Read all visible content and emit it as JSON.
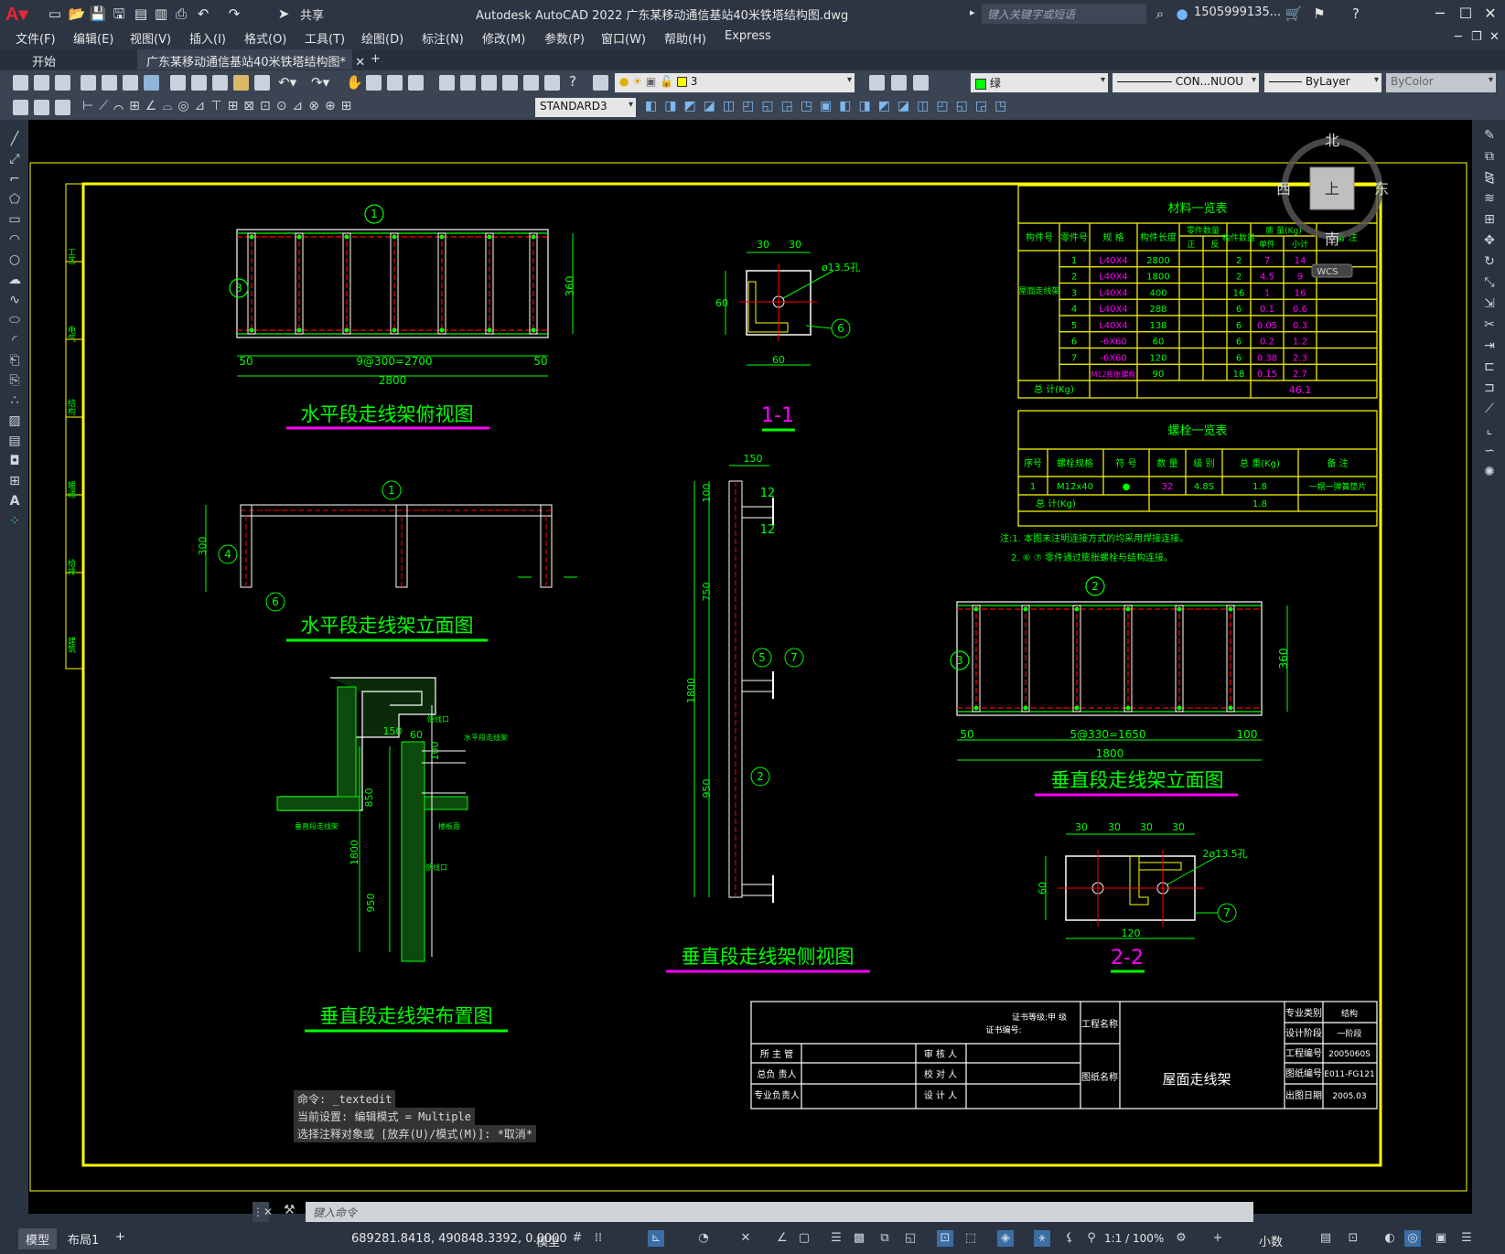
{
  "window": {
    "title": "Autodesk AutoCAD 2022    广东某移动通信基站40米铁塔结构图.dwg",
    "share": "共享",
    "search_placeholder": "键入关键字或短语",
    "user": "1505999135...",
    "minimize": "─",
    "maximize": "☐",
    "close": "✕"
  },
  "menu": [
    "文件(F)",
    "编辑(E)",
    "视图(V)",
    "插入(I)",
    "格式(O)",
    "工具(T)",
    "绘图(D)",
    "标注(N)",
    "修改(M)",
    "参数(P)",
    "窗口(W)",
    "帮助(H)",
    "Express"
  ],
  "tabs": {
    "start": "开始",
    "drawing": "广东某移动通信基站40米铁塔结构图*",
    "close": "✕",
    "add": "+"
  },
  "toolbar": {
    "layer": "3",
    "color": "绿",
    "linetype": "CON...NUOU",
    "lineweight": "ByLayer",
    "plotstyle": "ByColor",
    "textstyle": "STANDARD3"
  },
  "viewcube": {
    "north": "北",
    "south": "南",
    "east": "东",
    "west": "西",
    "top": "上",
    "wcs": "WCS"
  },
  "drawing": {
    "views": {
      "top_view_title": "水平段走线架俯视图",
      "elev_view_title": "水平段走线架立面图",
      "layout_title": "垂直段走线架布置图",
      "side_view_title": "垂直段走线架侧视图",
      "vert_elev_title": "垂直段走线架立面图",
      "sec11": "1-1",
      "sec22": "2-2"
    },
    "dims": {
      "d50a": "50",
      "d9at300": "9@300=2700",
      "d50b": "50",
      "d2800": "2800",
      "d360a": "360",
      "d30a": "30",
      "d30b": "30",
      "d60v": "60",
      "d60h": "60",
      "dphi1": "ø13.5孔",
      "d300": "300",
      "d150": "150",
      "d100": "100",
      "d750": "750",
      "d1800": "1800",
      "d950": "950",
      "d50c": "50",
      "d5at330": "5@330=1650",
      "d100b": "100",
      "d1800b": "1800",
      "d360b": "360",
      "d30c": "30",
      "d30d": "30",
      "d30e": "30",
      "d30f": "30",
      "d60b": "60",
      "d120": "120",
      "dphi2": "2ø13.5孔",
      "l150": "150",
      "l60": "60",
      "l100": "100",
      "l850": "850",
      "l1800": "1800",
      "l950": "950",
      "lbl_a": "馈线口",
      "lbl_b": "水平段走线架",
      "lbl_c": "垂直段走线架",
      "lbl_d": "楼板面",
      "lbl_e": "馈线口",
      "i12a": "12",
      "i12b": "12"
    },
    "callouts": {
      "c1": "1",
      "c3": "3",
      "c6": "6",
      "c1b": "1",
      "c4": "4",
      "c6b": "6",
      "c5": "5",
      "c7": "7",
      "c2": "2",
      "c2b": "2",
      "c3b": "3",
      "c7b": "7"
    },
    "material_table": {
      "title": "材料一览表",
      "headers": [
        "构件号",
        "零件号",
        "规  格",
        "构件长度",
        "零件数量",
        "构件数量",
        "质 量(Kg)",
        "备  注"
      ],
      "subheaders": [
        "正",
        "反",
        "单件",
        "小计"
      ],
      "group": "屋面走线架",
      "rows": [
        [
          "1",
          "L40X4",
          "2800",
          "2",
          "7",
          "14"
        ],
        [
          "2",
          "L40X4",
          "1800",
          "2",
          "4.5",
          "9"
        ],
        [
          "3",
          "L40X4",
          "400",
          "16",
          "1",
          "16"
        ],
        [
          "4",
          "L40X4",
          "288",
          "6",
          "0.1",
          "0.6"
        ],
        [
          "5",
          "L40X4",
          "138",
          "6",
          "0.05",
          "0.3"
        ],
        [
          "6",
          "-6X60",
          "60",
          "6",
          "0.2",
          "1.2"
        ],
        [
          "7",
          "-6X60",
          "120",
          "6",
          "0.38",
          "2.3"
        ],
        [
          "",
          "M12膨胀螺栓",
          "90",
          "18",
          "0.15",
          "2.7"
        ]
      ],
      "total_label": "总    计(Kg)",
      "total": "46.1"
    },
    "bolt_table": {
      "title": "螺栓一览表",
      "headers": [
        "序号",
        "螺栓规格",
        "符  号",
        "数  量",
        "级  别",
        "总 重(Kg)",
        "备  注"
      ],
      "row": [
        "1",
        "M12x40",
        "●",
        "32",
        "4.8S",
        "1.8",
        "一帽一弹簧垫片"
      ],
      "total_label": "总    计(Kg)",
      "total": "1.8"
    },
    "notes": {
      "n1": "注:1. 本图未注明连接方式的均采用焊接连接。",
      "n2": "2. ⑥ ⑦ 零件通过膨胀螺栓与结构连接。"
    },
    "title_block": {
      "cert_grade": "证书等级:甲          级",
      "cert_no": "证书编号:",
      "project_name": "工程名称",
      "drawing_name_lbl": "图纸名称",
      "drawing_name": "屋面走线架",
      "left_rows": [
        [
          "所 主 管",
          "审  核  人"
        ],
        [
          "总负 责人",
          "校  对  人"
        ],
        [
          "专业负责人",
          "设  计  人"
        ]
      ],
      "right_rows": [
        [
          "专业类别",
          "结构"
        ],
        [
          "设计阶段",
          "一阶段"
        ],
        [
          "工程编号",
          "2005060S"
        ],
        [
          "图纸编号",
          "E011-FG121"
        ],
        [
          "出图日期",
          "2005.03"
        ]
      ]
    },
    "side_labels": [
      "工艺",
      "电气",
      "结构",
      "暖通",
      "给排",
      "建筑"
    ]
  },
  "command": {
    "line1": "命令: _textedit",
    "line2": "当前设置: 编辑模式 = Multiple",
    "line3": "选择注释对象或 [放弃(U)/模式(M)]: *取消*",
    "placeholder": "键入命令"
  },
  "layout_tabs": {
    "model": "模型",
    "layout1": "布局1",
    "add": "+"
  },
  "status": {
    "coords": "689281.8418, 490848.3392, 0.0000",
    "model": "模型",
    "scale": "1:1 / 100%",
    "units": "小数"
  },
  "colors": {
    "yellow": "#ffff00",
    "green": "#00ff00",
    "cyan": "#00ffff",
    "magenta": "#ff00ff",
    "red": "#ff0000",
    "white": "#ffffff"
  }
}
